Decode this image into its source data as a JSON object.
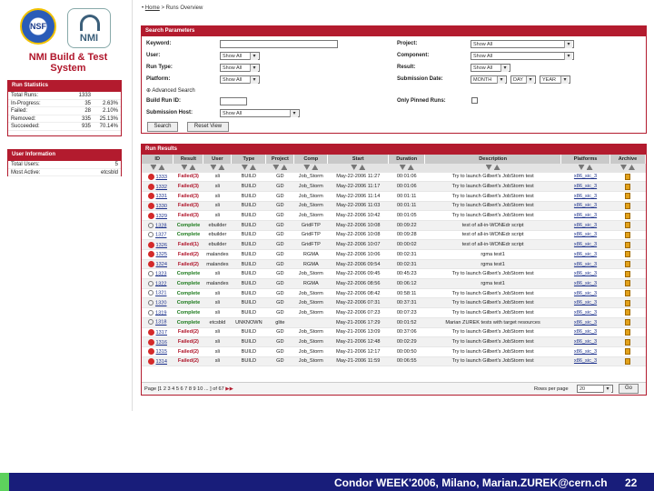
{
  "brand": {
    "nsf_label": "NSF",
    "nmi_label": "NMI",
    "line1": "NMI Build & Test",
    "line2": "System"
  },
  "breadcrumb": {
    "home": "Home",
    "sep": ">",
    "current": "Runs Overview"
  },
  "run_stats": {
    "title": "Run Statistics",
    "rows": [
      {
        "label": "Total Runs:",
        "count": "1333",
        "pct": ""
      },
      {
        "label": "In-Progress:",
        "count": "35",
        "pct": "2.63%"
      },
      {
        "label": "Failed:",
        "count": "28",
        "pct": "2.10%"
      },
      {
        "label": "Removed:",
        "count": "335",
        "pct": "25.13%"
      },
      {
        "label": "Succeeded:",
        "count": "935",
        "pct": "70.14%"
      }
    ]
  },
  "user_info": {
    "title": "User Information",
    "rows": [
      {
        "label": "Total Users:",
        "value": "5"
      },
      {
        "label": "Most Active:",
        "value": "etcsbld"
      }
    ]
  },
  "search": {
    "title": "Search Parameters",
    "keyword_label": "Keyword:",
    "user_label": "User:",
    "user_value": "Show All",
    "runtype_label": "Run Type:",
    "runtype_value": "Show All",
    "platform_label": "Platform:",
    "platform_value": "Show All",
    "advanced": "Advanced Search",
    "buildid_label": "Build Run ID:",
    "subhost_label": "Submission Host:",
    "subhost_value": "Show All",
    "project_label": "Project:",
    "project_value": "Show All",
    "component_label": "Component:",
    "component_value": "Show All",
    "result_label": "Result:",
    "result_value": "Show All",
    "subdate_label": "Submission Date:",
    "month": "MONTH",
    "day": "DAY",
    "year": "YEAR",
    "pinned_label": "Only Pinned Runs:",
    "search_btn": "Search",
    "reset_btn": "Reset View"
  },
  "results": {
    "title": "Run Results",
    "columns": [
      "ID",
      "Result",
      "User",
      "Type",
      "Project",
      "Comp",
      "Start",
      "Duration",
      "Description",
      "Platforms",
      "Archive"
    ],
    "rows": [
      {
        "status": "fail",
        "id": "1333",
        "result": "Failed(3)",
        "user": "sli",
        "type": "BUILD",
        "project": "GD",
        "comp": "Job_Storm",
        "start": "May-22-2006 11:27",
        "duration": "00:01:06",
        "desc": "Try to launch Gilbert's JobStorm test",
        "platform": "x86_sic_3"
      },
      {
        "status": "fail",
        "id": "1332",
        "result": "Failed(3)",
        "user": "sli",
        "type": "BUILD",
        "project": "GD",
        "comp": "Job_Storm",
        "start": "May-22-2006 11:17",
        "duration": "00:01:06",
        "desc": "Try to launch Gilbert's JobStorm test",
        "platform": "x86_sic_3"
      },
      {
        "status": "fail",
        "id": "1331",
        "result": "Failed(3)",
        "user": "sli",
        "type": "BUILD",
        "project": "GD",
        "comp": "Job_Storm",
        "start": "May-22-2006 11:14",
        "duration": "00:01:11",
        "desc": "Try to launch Gilbert's JobStorm test",
        "platform": "x86_sic_3"
      },
      {
        "status": "fail",
        "id": "1330",
        "result": "Failed(3)",
        "user": "sli",
        "type": "BUILD",
        "project": "GD",
        "comp": "Job_Storm",
        "start": "May-22-2006 11:03",
        "duration": "00:01:11",
        "desc": "Try to launch Gilbert's JobStorm test",
        "platform": "x86_sic_3"
      },
      {
        "status": "fail",
        "id": "1329",
        "result": "Failed(3)",
        "user": "sli",
        "type": "BUILD",
        "project": "GD",
        "comp": "Job_Storm",
        "start": "May-22-2006 10:42",
        "duration": "00:01:05",
        "desc": "Try to launch Gilbert's JobStorm test",
        "platform": "x86_sic_3"
      },
      {
        "status": "ok",
        "id": "1328",
        "result": "Complete",
        "user": "ebuilder",
        "type": "BUILD",
        "project": "GD",
        "comp": "GridFTP",
        "start": "May-22-2006 10:08",
        "duration": "00:09:22",
        "desc": "test of all-in-WONEdr script",
        "platform": "x86_sic_3"
      },
      {
        "status": "ok",
        "id": "1327",
        "result": "Complete",
        "user": "ebuilder",
        "type": "BUILD",
        "project": "GD",
        "comp": "GridFTP",
        "start": "May-22-2006 10:08",
        "duration": "00:09:28",
        "desc": "test of all-in-WONEdr script",
        "platform": "x86_sic_3"
      },
      {
        "status": "fail",
        "id": "1326",
        "result": "Failed(1)",
        "user": "ebuilder",
        "type": "BUILD",
        "project": "GD",
        "comp": "GridFTP",
        "start": "May-22-2006 10:07",
        "duration": "00:00:02",
        "desc": "test of all-in-WONEdr script",
        "platform": "x86_sic_3"
      },
      {
        "status": "fail",
        "id": "1325",
        "result": "Failed(2)",
        "user": "malandes",
        "type": "BUILD",
        "project": "GD",
        "comp": "RGMA",
        "start": "May-22-2006 10:06",
        "duration": "00:02:31",
        "desc": "rgma test1",
        "platform": "x86_sic_3"
      },
      {
        "status": "fail",
        "id": "1324",
        "result": "Failed(2)",
        "user": "malandes",
        "type": "BUILD",
        "project": "GD",
        "comp": "RGMA",
        "start": "May-22-2006 09:54",
        "duration": "00:02:31",
        "desc": "rgma test1",
        "platform": "x86_sic_3"
      },
      {
        "status": "ok",
        "id": "1323",
        "result": "Complete",
        "user": "sli",
        "type": "BUILD",
        "project": "GD",
        "comp": "Job_Storm",
        "start": "May-22-2006 09:45",
        "duration": "00:45:23",
        "desc": "Try to launch Gilbert's JobStorm test",
        "platform": "x86_sic_3"
      },
      {
        "status": "ok",
        "id": "1322",
        "result": "Complete",
        "user": "malandes",
        "type": "BUILD",
        "project": "GD",
        "comp": "RGMA",
        "start": "May-22-2006 08:56",
        "duration": "00:06:12",
        "desc": "rgma test1",
        "platform": "x86_sic_3"
      },
      {
        "status": "ok",
        "id": "1321",
        "result": "Complete",
        "user": "sli",
        "type": "BUILD",
        "project": "GD",
        "comp": "Job_Storm",
        "start": "May-22-2006 08:42",
        "duration": "00:58:11",
        "desc": "Try to launch Gilbert's JobStorm test",
        "platform": "x86_sic_3"
      },
      {
        "status": "ok",
        "id": "1320",
        "result": "Complete",
        "user": "sli",
        "type": "BUILD",
        "project": "GD",
        "comp": "Job_Storm",
        "start": "May-22-2006 07:31",
        "duration": "00:37:31",
        "desc": "Try to launch Gilbert's JobStorm test",
        "platform": "x86_sic_3"
      },
      {
        "status": "ok",
        "id": "1319",
        "result": "Complete",
        "user": "sli",
        "type": "BUILD",
        "project": "GD",
        "comp": "Job_Storm",
        "start": "May-22-2006 07:23",
        "duration": "00:07:23",
        "desc": "Try to launch Gilbert's JobStorm test",
        "platform": "x86_sic_3"
      },
      {
        "status": "ok",
        "id": "1318",
        "result": "Complete",
        "user": "etcsbld",
        "type": "UNKNOWN",
        "project": "glite",
        "comp": "",
        "start": "May-21-2006 17:29",
        "duration": "00:01:52",
        "desc": "Marian ZUREK tests with target resources",
        "platform": "x86_sic_3"
      },
      {
        "status": "fail",
        "id": "1317",
        "result": "Failed(2)",
        "user": "sli",
        "type": "BUILD",
        "project": "GD",
        "comp": "Job_Storm",
        "start": "May-21-2006 13:09",
        "duration": "00:37:06",
        "desc": "Try to launch Gilbert's JobStorm test",
        "platform": "x86_sic_3"
      },
      {
        "status": "fail",
        "id": "1316",
        "result": "Failed(2)",
        "user": "sli",
        "type": "BUILD",
        "project": "GD",
        "comp": "Job_Storm",
        "start": "May-21-2006 12:48",
        "duration": "00:02:29",
        "desc": "Try to launch Gilbert's JobStorm test",
        "platform": "x86_sic_3"
      },
      {
        "status": "fail",
        "id": "1315",
        "result": "Failed(2)",
        "user": "sli",
        "type": "BUILD",
        "project": "GD",
        "comp": "Job_Storm",
        "start": "May-21-2006 12:17",
        "duration": "00:00:50",
        "desc": "Try to launch Gilbert's JobStorm test",
        "platform": "x86_sic_3"
      },
      {
        "status": "fail",
        "id": "1314",
        "result": "Failed(2)",
        "user": "sli",
        "type": "BUILD",
        "project": "GD",
        "comp": "Job_Storm",
        "start": "May-21-2006 11:59",
        "duration": "00:06:55",
        "desc": "Try to launch Gilbert's JobStorm test",
        "platform": "x86_sic_3"
      }
    ],
    "pager_text": "Page [1 2 3 4 5 6 7 8 9 10 ... ] of 67",
    "rows_per_page_label": "Rows per page",
    "rows_per_page_value": "20",
    "go_btn": "Go"
  },
  "footer": {
    "text": "Condor WEEK'2006, Milano, Marian.ZUREK@cern.ch",
    "page": "22"
  },
  "colors": {
    "accent": "#b31b2e",
    "footer_bg": "#181d7a"
  }
}
